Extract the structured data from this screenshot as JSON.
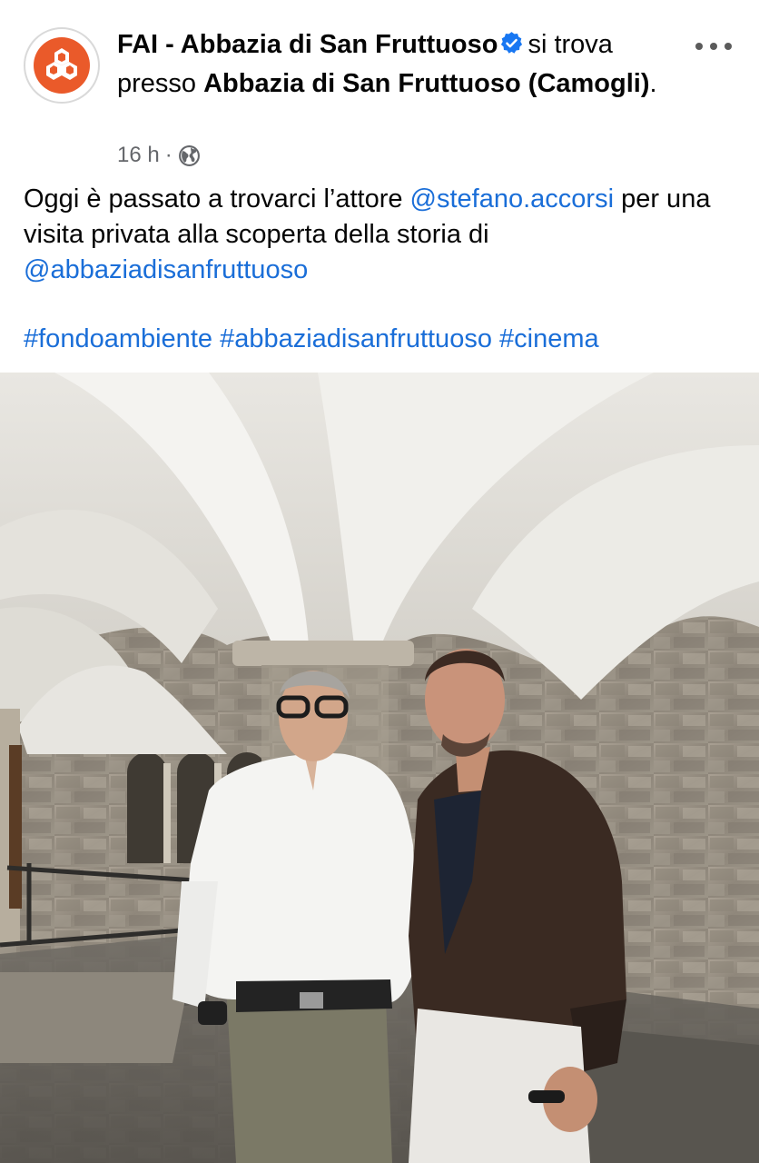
{
  "post": {
    "author": "FAI - Abbazia di San Fruttuoso",
    "location_prefix": "si trova presso",
    "location": "Abbazia di San Fruttuoso (Camogli)",
    "location_suffix": ".",
    "time": "16 h",
    "separator": "·",
    "audience_icon": "globe-icon",
    "verified_icon": "verified-badge-icon",
    "more_icon": "more-options-icon",
    "text_part1": "Oggi è passato a trovarci l’attore ",
    "mention1": "@stefano.accorsi",
    "text_part2": " per una visita privata alla scoperta della storia di ",
    "mention2": "@abbaziadisanfruttuoso",
    "hashtags": [
      "#fondoambiente",
      "#abbaziadisanfruttuoso",
      "#cinema"
    ]
  },
  "colors": {
    "link": "#1a6ed8",
    "brand": "#ea5a2a",
    "verified": "#1877f2",
    "meta": "#65676b"
  }
}
